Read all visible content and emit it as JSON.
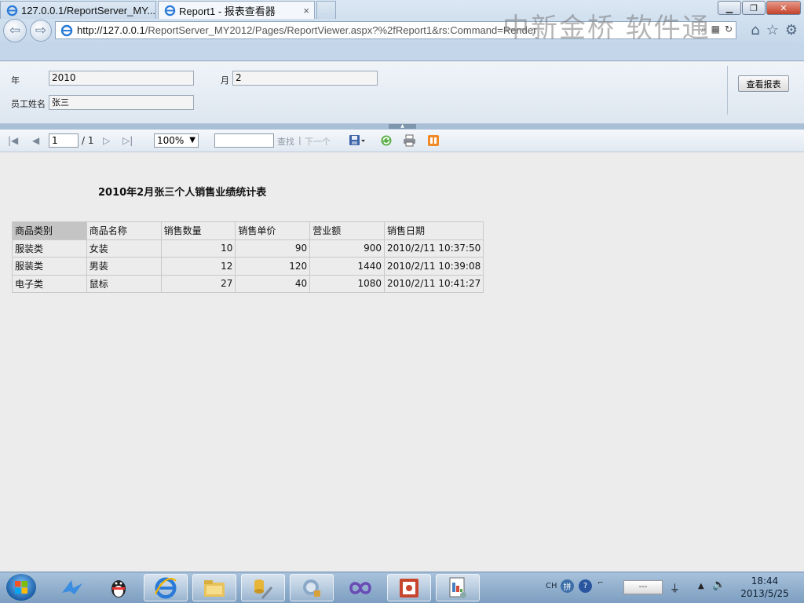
{
  "browser": {
    "url_host": "http://127.0.0.1",
    "url_path": "/ReportServer_MY2012/Pages/ReportViewer.aspx?%2fReport1&rs:Command=Render",
    "watermark": "中新金桥 软件通",
    "tabs": [
      {
        "label": "127.0.0.1/ReportServer_MY..."
      },
      {
        "label": "Report1 - 报表查看器",
        "close": "×"
      }
    ]
  },
  "params": {
    "year_label": "年",
    "year_value": "2010",
    "month_label": "月",
    "month_value": "2",
    "employee_label": "员工姓名",
    "employee_value": "张三",
    "view_report_label": "查看报表"
  },
  "toolbar": {
    "page_current": "1",
    "page_total": "/ 1",
    "zoom": "100%",
    "find_label": "查找",
    "find_separator": "|",
    "next_label": "下一个"
  },
  "report": {
    "title": "2010年2月张三个人销售业绩统计表",
    "columns": [
      "商品类别",
      "商品名称",
      "销售数量",
      "销售单价",
      "营业额",
      "销售日期"
    ],
    "rows": [
      [
        "服装类",
        "女装",
        "10",
        "90",
        "900",
        "2010/2/11 10:37:50"
      ],
      [
        "服装类",
        "男装",
        "12",
        "120",
        "1440",
        "2010/2/11 10:39:08"
      ],
      [
        "电子类",
        "鼠标",
        "27",
        "40",
        "1080",
        "2010/2/11 10:41:27"
      ]
    ]
  },
  "taskbar": {
    "lang": "CH",
    "tray_box": "---",
    "time": "18:44",
    "date": "2013/5/25"
  },
  "colors": {
    "chrome_blue": "#c6d8ea",
    "header_highlight": "#c4c4c4",
    "report_bg": "#ececec"
  }
}
